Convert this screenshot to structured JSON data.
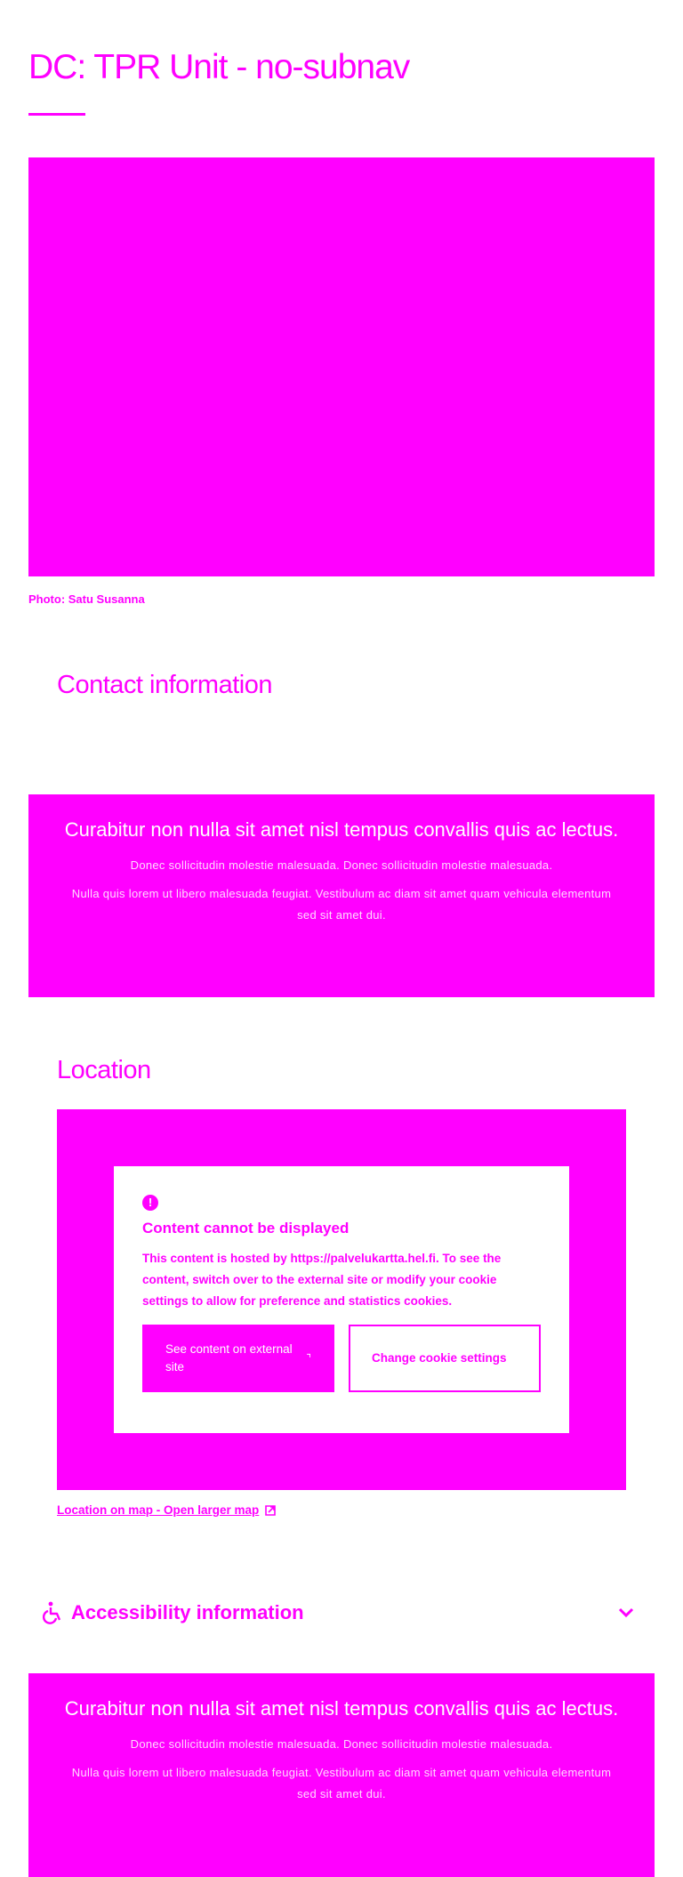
{
  "page": {
    "title": "DC: TPR Unit - no-subnav"
  },
  "hero": {
    "caption": "Photo: Satu Susanna"
  },
  "contact": {
    "heading": "Contact information"
  },
  "promo": {
    "title": "Curabitur non nulla sit amet nisl tempus convallis quis ac lectus.",
    "text1": "Donec sollicitudin molestie malesuada. Donec sollicitudin molestie malesuada.",
    "text2": "Nulla quis lorem ut libero malesuada feugiat. Vestibulum ac diam sit amet quam vehicula elementum sed sit amet dui."
  },
  "location": {
    "heading": "Location",
    "notice": {
      "icon": "!",
      "title": "Content cannot be displayed",
      "text": "This content is hosted by https://palvelukartta.hel.fi. To see the content, switch over to the external site or modify your cookie settings to allow for preference and statistics cookies.",
      "primary_button": "See content on external site",
      "secondary_button": "Change cookie settings"
    },
    "map_link": "Location on map - Open larger map"
  },
  "accessibility": {
    "label": "Accessibility information"
  },
  "colors": {
    "accent": "#ff00ff",
    "background": "#ffffff"
  },
  "icons": {
    "alert": "alert-circle-icon",
    "external": "external-link-icon",
    "accessibility": "wheelchair-icon",
    "chevron": "chevron-down-icon"
  }
}
